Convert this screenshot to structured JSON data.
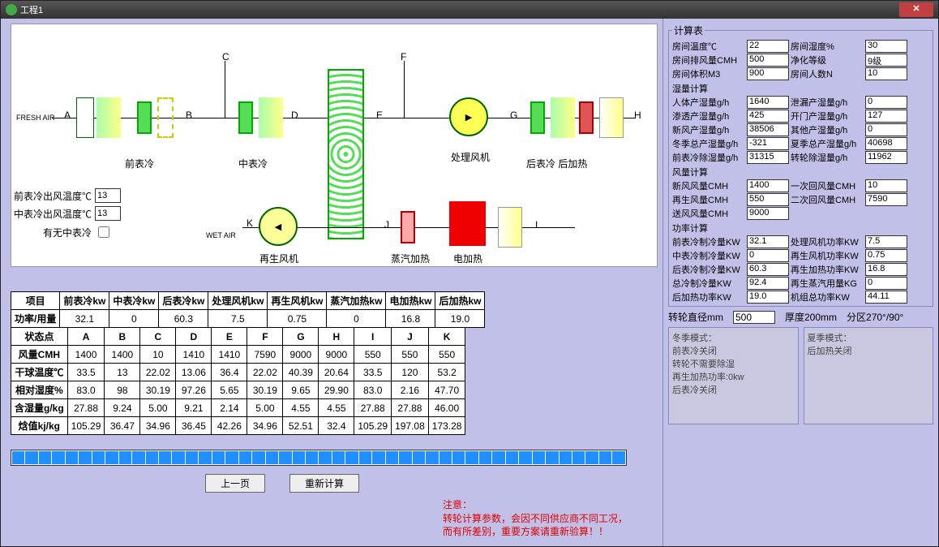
{
  "window_title": "工程1",
  "diagram": {
    "fresh_air": "FRESH AIR",
    "wet_air": "WET AIR",
    "points": [
      "A",
      "B",
      "C",
      "D",
      "E",
      "F",
      "G",
      "H",
      "I",
      "J",
      "K"
    ],
    "labels": {
      "precool": "前表冷",
      "midcool": "中表冷",
      "postcool_heat": "后表冷 后加热",
      "proc_fan": "处理风机",
      "regen_fan": "再生风机",
      "steam_heat": "蒸汽加热",
      "elec_heat": "电加热"
    }
  },
  "inputs": {
    "precool_out_label": "前表冷出风温度℃",
    "precool_out": "13",
    "midcool_out_label": "中表冷出风温度℃",
    "midcool_out": "13",
    "has_midcool_label": "有无中表冷"
  },
  "power_table": {
    "row_label": "项目",
    "headers": [
      "前表冷kw",
      "中表冷kw",
      "后表冷kw",
      "处理风机kw",
      "再生风机kw",
      "蒸汽加热kw",
      "电加热kw",
      "后加热kw"
    ],
    "power_label": "功率/用量",
    "values": [
      "32.1",
      "0",
      "60.3",
      "7.5",
      "0.75",
      "0",
      "16.8",
      "19.0"
    ]
  },
  "state_table": {
    "row_label": "状态点",
    "cols": [
      "A",
      "B",
      "C",
      "D",
      "E",
      "F",
      "G",
      "H",
      "I",
      "J",
      "K"
    ],
    "rows": [
      {
        "label": "风量CMH",
        "v": [
          "1400",
          "1400",
          "10",
          "1410",
          "1410",
          "7590",
          "9000",
          "9000",
          "550",
          "550",
          "550"
        ]
      },
      {
        "label": "干球温度℃",
        "v": [
          "33.5",
          "13",
          "22.02",
          "13.06",
          "36.4",
          "22.02",
          "40.39",
          "20.64",
          "33.5",
          "120",
          "53.2"
        ]
      },
      {
        "label": "相对湿度%",
        "v": [
          "83.0",
          "98",
          "30.19",
          "97.26",
          "5.65",
          "30.19",
          "9.65",
          "29.90",
          "83.0",
          "2.16",
          "47.70"
        ]
      },
      {
        "label": "含湿量g/kg",
        "v": [
          "27.88",
          "9.24",
          "5.00",
          "9.21",
          "2.14",
          "5.00",
          "4.55",
          "4.55",
          "27.88",
          "27.88",
          "46.00"
        ]
      },
      {
        "label": "焓值kj/kg",
        "v": [
          "105.29",
          "36.47",
          "34.96",
          "36.45",
          "42.26",
          "34.96",
          "52.51",
          "32.4",
          "105.29",
          "197.08",
          "173.28"
        ]
      }
    ]
  },
  "buttons": {
    "prev": "上一页",
    "recalc": "重新计算"
  },
  "warning": {
    "title": "注意：",
    "l1": "转轮计算参数，会因不同供应商不同工况，",
    "l2": "而有所差别，重要方案请重新验算！！"
  },
  "calc": {
    "legend": "计算表",
    "room_temp_l": "房间温度℃",
    "room_temp": "22",
    "room_hum_l": "房间湿度%",
    "room_hum": "30",
    "exhaust_l": "房间排风量CMH",
    "exhaust": "500",
    "clean_l": "净化等级",
    "clean": "9级",
    "volume_l": "房间体积M3",
    "volume": "900",
    "people_l": "房间人数N",
    "people": "10",
    "hum_legend": "湿量计算",
    "body_hum_l": "人体产湿量g/h",
    "body_hum": "1640",
    "leak_hum_l": "泄漏产湿量g/h",
    "leak_hum": "0",
    "perm_hum_l": "渗透产湿量g/h",
    "perm_hum": "425",
    "door_hum_l": "开门产湿量g/h",
    "door_hum": "127",
    "fresh_hum_l": "新风产湿量g/h",
    "fresh_hum": "38506",
    "other_hum_l": "其他产湿量g/h",
    "other_hum": "0",
    "winter_tot_l": "冬季总产湿量g/h",
    "winter_tot": "-321",
    "summer_tot_l": "夏季总产湿量g/h",
    "summer_tot": "40698",
    "precool_dehum_l": "前表冷除湿量g/h",
    "precool_dehum": "31315",
    "wheel_dehum_l": "转轮除湿量g/h",
    "wheel_dehum": "11962",
    "air_legend": "风量计算",
    "fresh_air_l": "新风风量CMH",
    "fresh_air": "1400",
    "ret1_l": "一次回风量CMH",
    "ret1": "10",
    "regen_l": "再生风量CMH",
    "regen": "550",
    "ret2_l": "二次回风量CMH",
    "ret2": "7590",
    "supply_l": "送风风量CMH",
    "supply": "9000",
    "pwr_legend": "功率计算",
    "precool_pwr_l": "前表冷制冷量KW",
    "precool_pwr": "32.1",
    "procfan_pwr_l": "处理风机功率KW",
    "procfan_pwr": "7.5",
    "midcool_pwr_l": "中表冷制冷量KW",
    "midcool_pwr": "0",
    "regenfan_pwr_l": "再生风机功率KW",
    "regenfan_pwr": "0.75",
    "postcool_pwr_l": "后表冷制冷量KW",
    "postcool_pwr": "60.3",
    "regenheat_pwr_l": "再生加热功率KW",
    "regenheat_pwr": "16.8",
    "totcool_pwr_l": "总冷制冷量KW",
    "totcool_pwr": "92.4",
    "regensteam_l": "再生蒸汽用量KG",
    "regensteam": "0",
    "postheat_pwr_l": "后加热功率KW",
    "postheat_pwr": "19.0",
    "unit_tot_l": "机组总功率KW",
    "unit_tot": "44.11",
    "wheel_dia_l": "转轮直径mm",
    "wheel_dia": "500",
    "wheel_thick_l": "厚度200mm　分区270°/90°"
  },
  "modes": {
    "winter_title": "冬季模式：",
    "winter_body": "前表冷关闭\n转轮不需要除湿\n再生加热功率:0kw\n后表冷关闭",
    "summer_title": "夏季模式：",
    "summer_body": "后加热关闭"
  }
}
